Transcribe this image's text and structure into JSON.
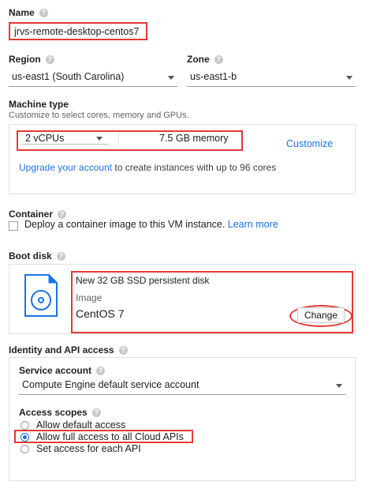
{
  "name": {
    "label": "Name",
    "value": "jrvs-remote-desktop-centos7"
  },
  "region": {
    "label": "Region",
    "value": "us-east1 (South Carolina)"
  },
  "zone": {
    "label": "Zone",
    "value": "us-east1-b"
  },
  "machine_type": {
    "label": "Machine type",
    "subtitle": "Customize to select cores, memory and GPUs.",
    "cpus": "2 vCPUs",
    "memory": "7.5 GB memory",
    "customize_link": "Customize",
    "upgrade_link": "Upgrade your account",
    "upgrade_text": " to create instances with up to 96 cores"
  },
  "container": {
    "label": "Container",
    "checkbox_text": "Deploy a container image to this VM instance.",
    "learn_more": "Learn more"
  },
  "boot_disk": {
    "label": "Boot disk",
    "disk": "New 32 GB SSD persistent disk",
    "image_label": "Image",
    "image": "CentOS 7",
    "change_button": "Change"
  },
  "identity": {
    "label": "Identity and API access",
    "service_account_label": "Service account",
    "service_account_value": "Compute Engine default service account",
    "access_scopes_label": "Access scopes",
    "scopes": [
      "Allow default access",
      "Allow full access to all Cloud APIs",
      "Set access for each API"
    ],
    "selected_scope": "Allow full access to all Cloud APIs"
  },
  "colors": {
    "accent": "#1a73e8",
    "highlight": "#e53935"
  }
}
